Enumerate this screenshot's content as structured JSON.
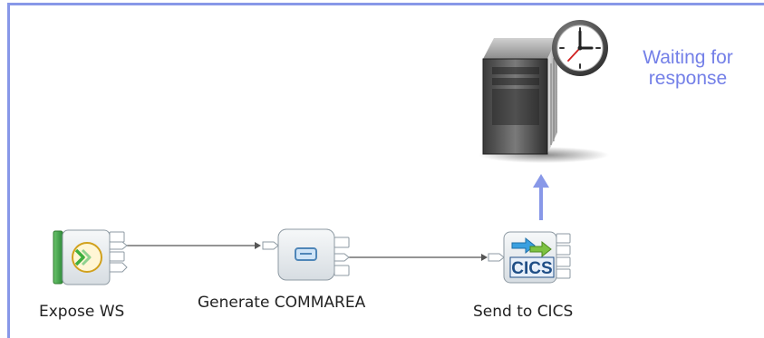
{
  "nodes": [
    {
      "id": "expose-ws",
      "label": "Expose WS"
    },
    {
      "id": "generate-commarea",
      "label": "Generate COMMAREA"
    },
    {
      "id": "send-to-cics",
      "label": "Send to CICS"
    }
  ],
  "cics_badge": "CICS",
  "status": {
    "line1": "Waiting for",
    "line2": "response"
  },
  "colors": {
    "frame": "#8898e8",
    "arrow": "#8898e8",
    "status_text": "#7480e8",
    "connector": "#555555"
  },
  "icons": [
    "web-service-input-icon",
    "compute-node-icon",
    "cics-request-icon",
    "server-icon",
    "clock-icon"
  ]
}
